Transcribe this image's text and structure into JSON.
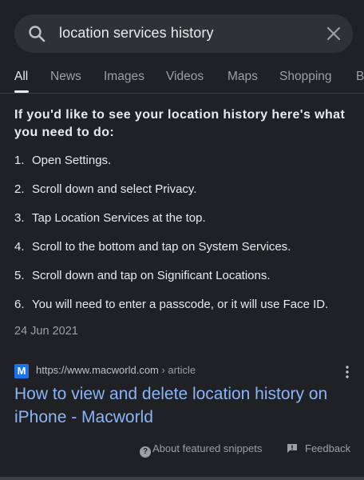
{
  "search": {
    "query": "location services history"
  },
  "tabs": [
    {
      "label": "All",
      "active": true
    },
    {
      "label": "News"
    },
    {
      "label": "Images"
    },
    {
      "label": "Videos"
    },
    {
      "label": "Maps"
    },
    {
      "label": "Shopping"
    },
    {
      "label": "B"
    }
  ],
  "snippet": {
    "heading": "If you'd like to see your location history here's what you need to do:",
    "steps": [
      {
        "num": "1.",
        "text": "Open Settings."
      },
      {
        "num": "2.",
        "text": "Scroll down and select Privacy."
      },
      {
        "num": "3.",
        "text": "Tap Location Services at the top."
      },
      {
        "num": "4.",
        "text": "Scroll to the bottom and tap on System Services."
      },
      {
        "num": "5.",
        "text": "Scroll down and tap on Significant Locations."
      },
      {
        "num": "6.",
        "text": "You will need to enter a passcode, or it will use Face ID."
      }
    ],
    "date": "24 Jun 2021"
  },
  "result": {
    "favicon_letter": "M",
    "url": "https://www.macworld.com",
    "path": " › article",
    "title": "How to view and delete location history on iPhone - Macworld"
  },
  "footer": {
    "about_label": "About featured snippets",
    "feedback_label": "Feedback"
  },
  "colors": {
    "background": "#202124",
    "search_box": "#303134",
    "link": "#8ab4f8",
    "muted": "#9aa0a6"
  }
}
